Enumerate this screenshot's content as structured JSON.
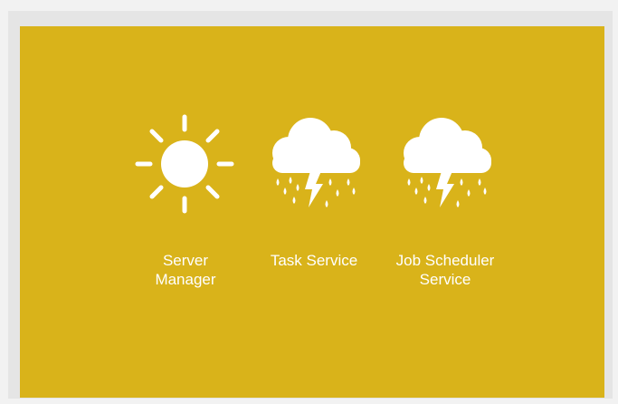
{
  "tiles": [
    {
      "label": "Server\nManager",
      "icon": "sun-icon",
      "status_color": "#ffffff"
    },
    {
      "label": "Task Service",
      "icon": "storm-icon",
      "status_color": "#ffffff"
    },
    {
      "label": "Job Scheduler Service",
      "icon": "storm-icon",
      "status_color": "#ffffff"
    }
  ],
  "colors": {
    "tile_background": "#d9b31a",
    "page_background": "#f2f2f2",
    "icon_color": "#ffffff"
  }
}
